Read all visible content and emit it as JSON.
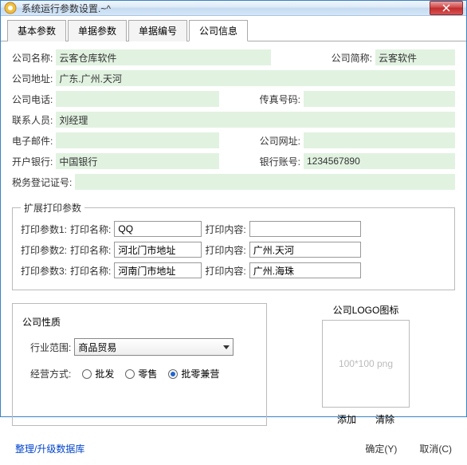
{
  "title": "系统运行参数设置.~^",
  "tabs": [
    "基本参数",
    "单据参数",
    "单据编号",
    "公司信息"
  ],
  "active_tab": 3,
  "fields": {
    "company_name": {
      "label": "公司名称:",
      "value": "云客仓库软件"
    },
    "company_short": {
      "label": "公司简称:",
      "value": "云客软件"
    },
    "company_addr": {
      "label": "公司地址:",
      "value": "广东.广州.天河"
    },
    "company_phone": {
      "label": "公司电话:",
      "value": ""
    },
    "fax": {
      "label": "传真号码:",
      "value": ""
    },
    "contact": {
      "label": "联系人员:",
      "value": "刘经理"
    },
    "email": {
      "label": "电子邮件:",
      "value": ""
    },
    "website": {
      "label": "公司网址:",
      "value": ""
    },
    "bank": {
      "label": "开户银行:",
      "value": "中国银行"
    },
    "bank_acct": {
      "label": "银行账号:",
      "value": "1234567890"
    },
    "tax_reg": {
      "label": "税务登记证号:",
      "value": ""
    }
  },
  "print_section": {
    "legend": "扩展打印参数",
    "rows": [
      {
        "param": "打印参数1:",
        "name_label": "打印名称:",
        "name_value": "QQ",
        "content_label": "打印内容:",
        "content_value": ""
      },
      {
        "param": "打印参数2:",
        "name_label": "打印名称:",
        "name_value": "河北门市地址",
        "content_label": "打印内容:",
        "content_value": "广州.天河"
      },
      {
        "param": "打印参数3:",
        "name_label": "打印名称:",
        "name_value": "河南门市地址",
        "content_label": "打印内容:",
        "content_value": "广州.海珠"
      }
    ]
  },
  "nature": {
    "title": "公司性质",
    "industry_label": "行业范围:",
    "industry_value": "商品贸易",
    "mode_label": "经营方式:",
    "mode_options": [
      "批发",
      "零售",
      "批零兼营"
    ],
    "mode_selected": 2
  },
  "logo": {
    "title": "公司LOGO图标",
    "placeholder": "100*100 png",
    "add": "添加",
    "clear": "清除"
  },
  "footer": {
    "link": "整理/升级数据库",
    "ok": "确定(Y)",
    "cancel": "取消(C)"
  }
}
